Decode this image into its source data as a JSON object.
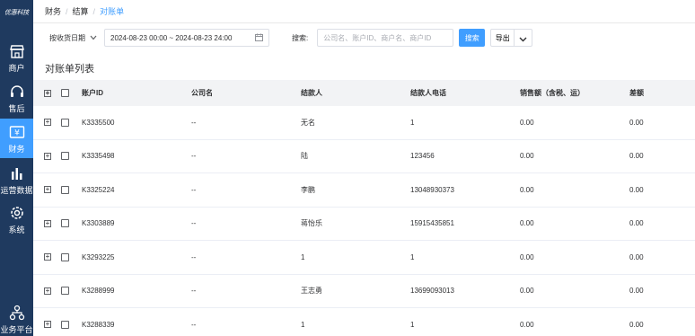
{
  "sidebar": {
    "logo": "优惠科技",
    "items": [
      {
        "label": "商户",
        "icon": "store-icon"
      },
      {
        "label": "售后",
        "icon": "headset-icon"
      },
      {
        "label": "财务",
        "icon": "finance-icon",
        "active": true
      },
      {
        "label": "运营数据",
        "icon": "bar-chart-icon"
      },
      {
        "label": "系统",
        "icon": "gear-icon"
      },
      {
        "label": "业务平台",
        "icon": "network-icon"
      }
    ]
  },
  "breadcrumb": [
    "财务",
    "结算",
    "对账单"
  ],
  "filter": {
    "date_type": "按收货日期",
    "date_range": "2024-08-23 00:00 ~ 2024-08-23 24:00",
    "search_label": "搜索:",
    "search_placeholder": "公司名、账户ID、商户名、商户ID",
    "search_button": "搜索",
    "export_button": "导出"
  },
  "section_title": "对账单列表",
  "table": {
    "columns": [
      "账户ID",
      "公司名",
      "结款人",
      "结款人电话",
      "销售额（含税、运）",
      "差额"
    ],
    "rows": [
      [
        "K3335500",
        "--",
        "无名",
        "1",
        "0.00",
        "0.00"
      ],
      [
        "K3335498",
        "--",
        "陆",
        "123456",
        "0.00",
        "0.00"
      ],
      [
        "K3325224",
        "--",
        "李鹏",
        "13048930373",
        "0.00",
        "0.00"
      ],
      [
        "K3303889",
        "--",
        "蒋怡乐",
        "15915435851",
        "0.00",
        "0.00"
      ],
      [
        "K3293225",
        "--",
        "1",
        "1",
        "0.00",
        "0.00"
      ],
      [
        "K3288999",
        "--",
        "王志勇",
        "13699093013",
        "0.00",
        "0.00"
      ],
      [
        "K3288339",
        "--",
        "1",
        "1",
        "0.00",
        "0.00"
      ]
    ]
  },
  "colors": {
    "sidebar": "#1f3a5f",
    "accent": "#409eff"
  }
}
